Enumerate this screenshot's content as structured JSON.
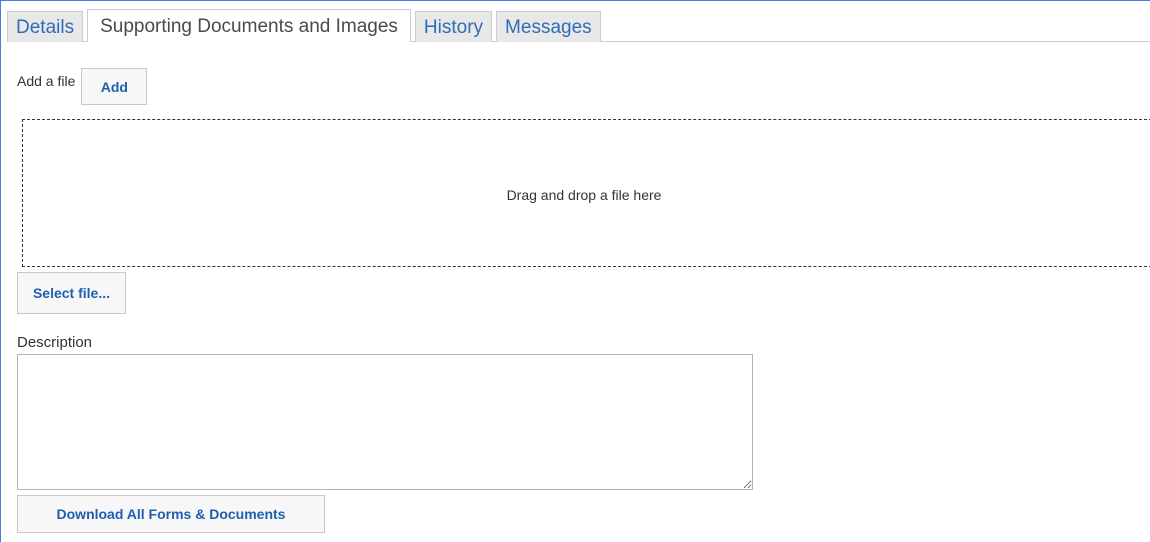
{
  "tabs": {
    "details": "Details",
    "supporting": "Supporting Documents and Images",
    "history": "History",
    "messages": "Messages"
  },
  "upload": {
    "add_label": "Add a file",
    "add_button": "Add",
    "dropzone_text": "Drag and drop a file here",
    "select_button": "Select file..."
  },
  "description": {
    "label": "Description",
    "value": ""
  },
  "actions": {
    "download_all": "Download All Forms & Documents"
  },
  "colors": {
    "accent_link": "#2f6db5",
    "frame_border": "#4a7fd4",
    "tab_inactive_bg": "#e8e8e8"
  }
}
